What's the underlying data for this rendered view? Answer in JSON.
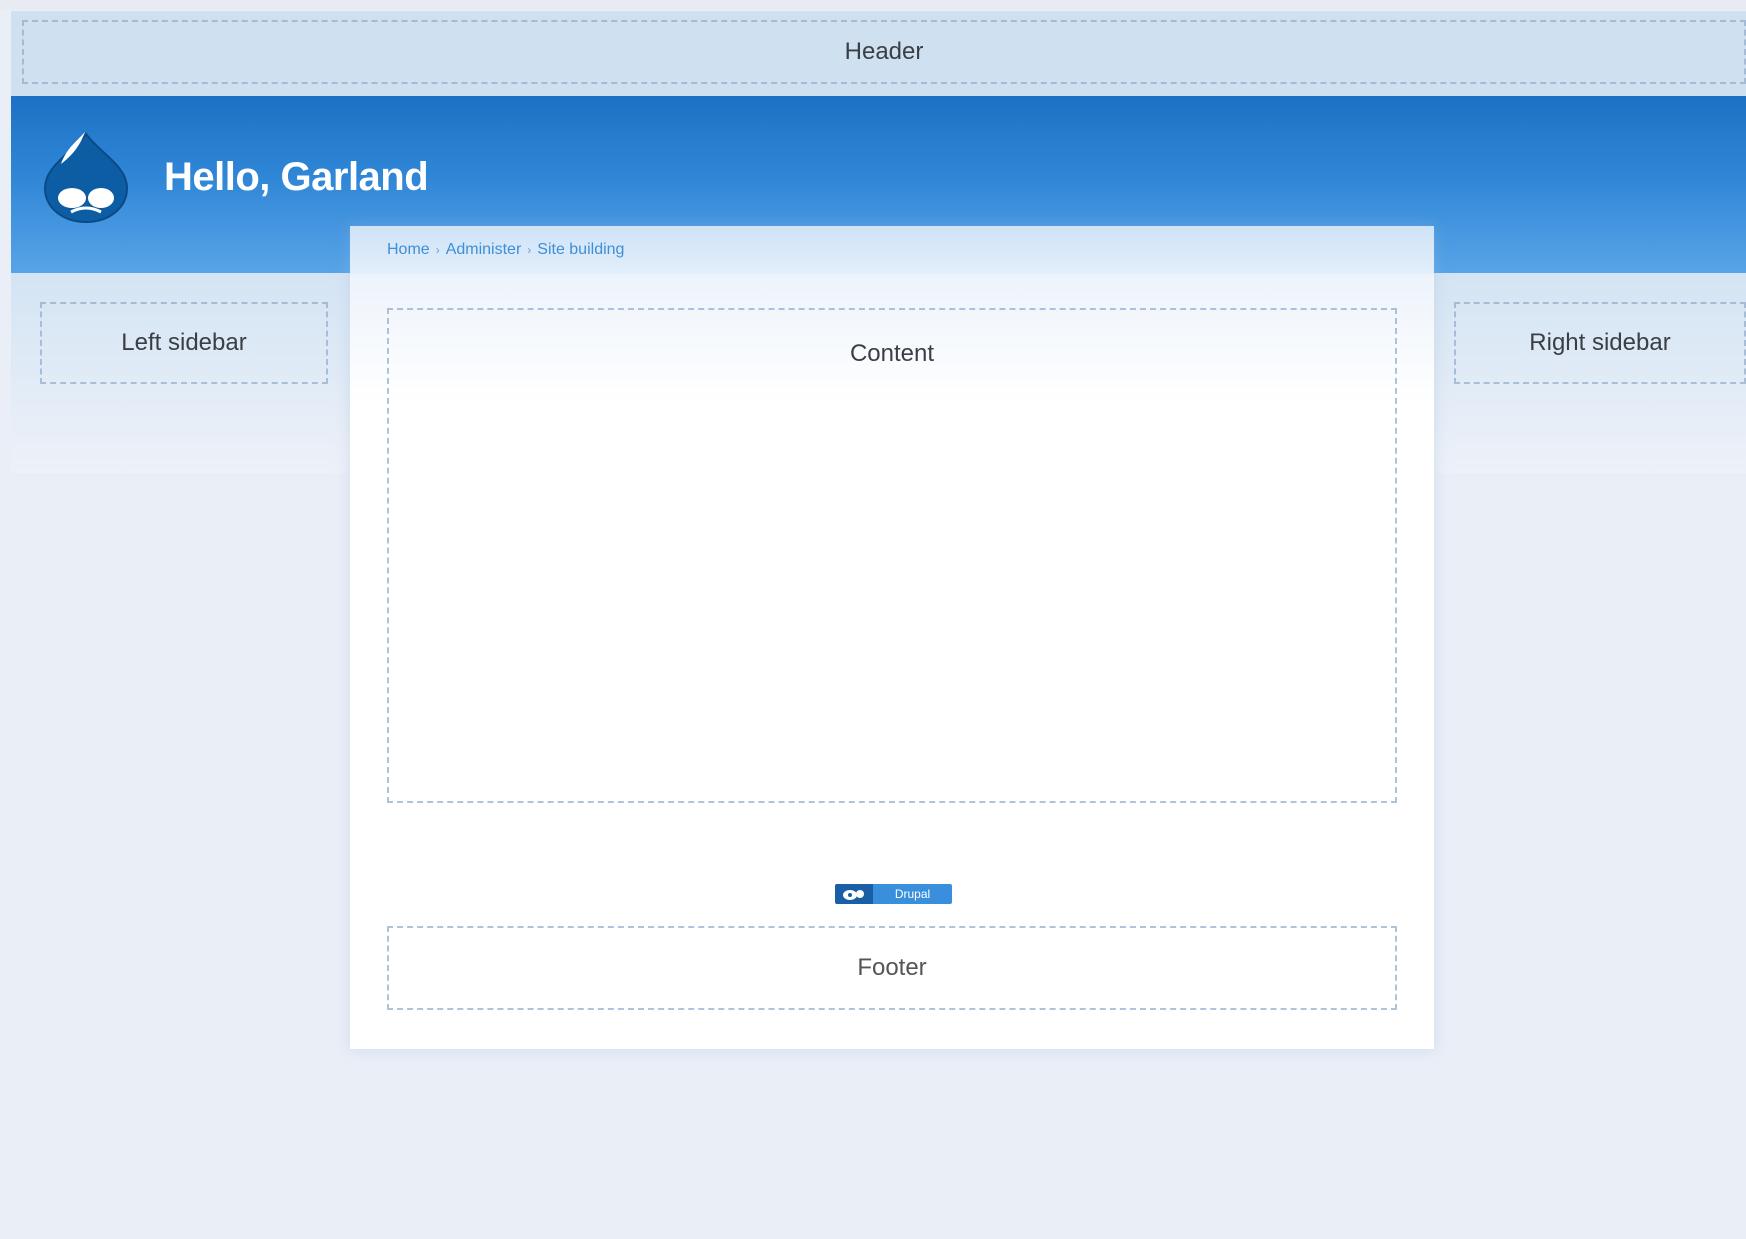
{
  "header": {
    "region_label": "Header"
  },
  "site": {
    "name": "Hello, Garland",
    "logo_icon": "drupal-drop-icon"
  },
  "breadcrumb": {
    "items": [
      "Home",
      "Administer",
      "Site building"
    ],
    "separator": "›"
  },
  "regions": {
    "content": "Content",
    "footer": "Footer",
    "left_sidebar": "Left sidebar",
    "right_sidebar": "Right sidebar"
  },
  "badge": {
    "label": "Drupal",
    "icon": "drupal-logo-icon"
  },
  "colors": {
    "banner_top": "#1d71c4",
    "banner_bottom": "#58a4e8",
    "link": "#3d8fd6",
    "page_bg": "#edf1f9"
  }
}
